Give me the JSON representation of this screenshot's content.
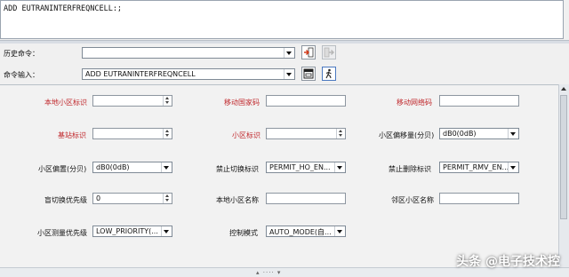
{
  "output": {
    "text": "ADD EUTRANINTERFREQNCELL:;"
  },
  "history": {
    "label": "历史命令：",
    "value": ""
  },
  "command": {
    "label": "命令输入：",
    "value": "ADD EUTRANINTERFREQNCELL"
  },
  "fields": {
    "local_cell_id": {
      "label": "本地小区标识",
      "value": ""
    },
    "mcc": {
      "label": "移动国家码",
      "value": ""
    },
    "mnc": {
      "label": "移动网络码",
      "value": ""
    },
    "enodeb_id": {
      "label": "基站标识",
      "value": ""
    },
    "cell_id": {
      "label": "小区标识",
      "value": ""
    },
    "cell_offset": {
      "label": "小区偏移量(分贝)",
      "value": "dB0(0dB)"
    },
    "cell_bias": {
      "label": "小区偏置(分贝)",
      "value": "dB0(0dB)"
    },
    "no_ho_ind": {
      "label": "禁止切换标识",
      "value": "PERMIT_HO_EN..."
    },
    "no_rmv_ind": {
      "label": "禁止删除标识",
      "value": "PERMIT_RMV_EN..."
    },
    "blind_ho_priority": {
      "label": "盲切换优先级",
      "value": "0"
    },
    "local_cell_name": {
      "label": "本地小区名称",
      "value": ""
    },
    "neighbour_cell_name": {
      "label": "邻区小区名称",
      "value": ""
    },
    "meas_priority": {
      "label": "小区测量优先级",
      "value": "LOW_PRIORITY(..."
    },
    "ctrl_mode": {
      "label": "控制模式",
      "value": "AUTO_MODE(自..."
    }
  },
  "watermark": "头条 @电子技术控"
}
